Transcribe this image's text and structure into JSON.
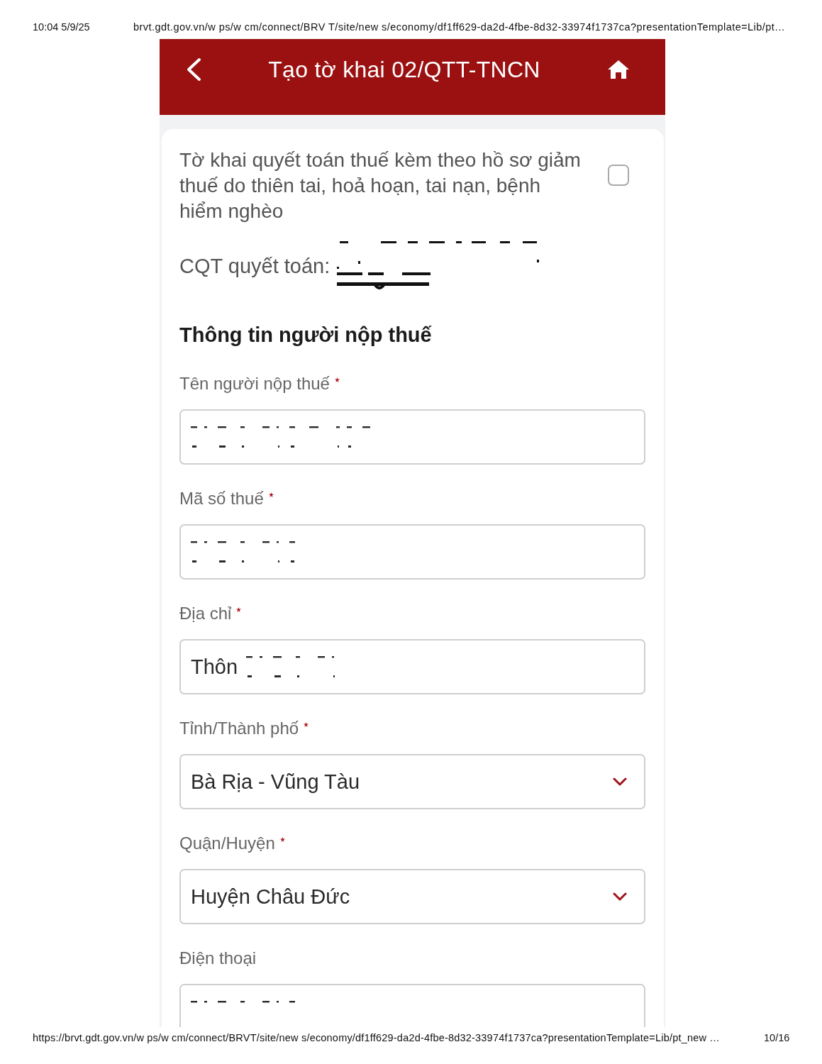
{
  "print_header": {
    "datetime": "10:04 5/9/25",
    "url": "brvt.gdt.gov.vn/w ps/w cm/connect/BRV T/site/new s/economy/df1ff629-da2d-4fbe-8d32-33974f1737ca?presentationTemplate=Lib/pt…"
  },
  "app_bar": {
    "title": "Tạo tờ khai 02/QTT-TNCN"
  },
  "reduction_option": {
    "label": "Tờ khai quyết toán thuế kèm theo hồ sơ giảm thuế do thiên tai, hoả hoạn, tai nạn, bệnh hiểm nghèo",
    "checked": false
  },
  "tax_office": {
    "label": "CQT quyết toán:",
    "obscured": true
  },
  "section_title": "Thông tin người nộp thuế",
  "fields": [
    {
      "kind": "text",
      "label": "Tên người nộp thuế",
      "required": true,
      "obscured": true
    },
    {
      "kind": "text",
      "label": "Mã số thuế",
      "required": true,
      "obscured": true
    },
    {
      "kind": "text",
      "label": "Địa chỉ",
      "required": true,
      "value": "Thôn",
      "obscured": true
    },
    {
      "kind": "select",
      "label": "Tỉnh/Thành phố",
      "required": true,
      "value": "Bà Rịa - Vũng Tàu",
      "obscured": false
    },
    {
      "kind": "select",
      "label": "Quận/Huyện",
      "required": true,
      "value": "Huyện Châu Đức",
      "obscured": false
    },
    {
      "kind": "text",
      "label": "Điện thoại",
      "required": false,
      "obscured": true
    }
  ],
  "print_footer": {
    "url": "https://brvt.gdt.gov.vn/w ps/w cm/connect/BRVT/site/new s/economy/df1ff629-da2d-4fbe-8d32-33974f1737ca?presentationTemplate=Lib/pt_new …",
    "page": "10/16"
  }
}
